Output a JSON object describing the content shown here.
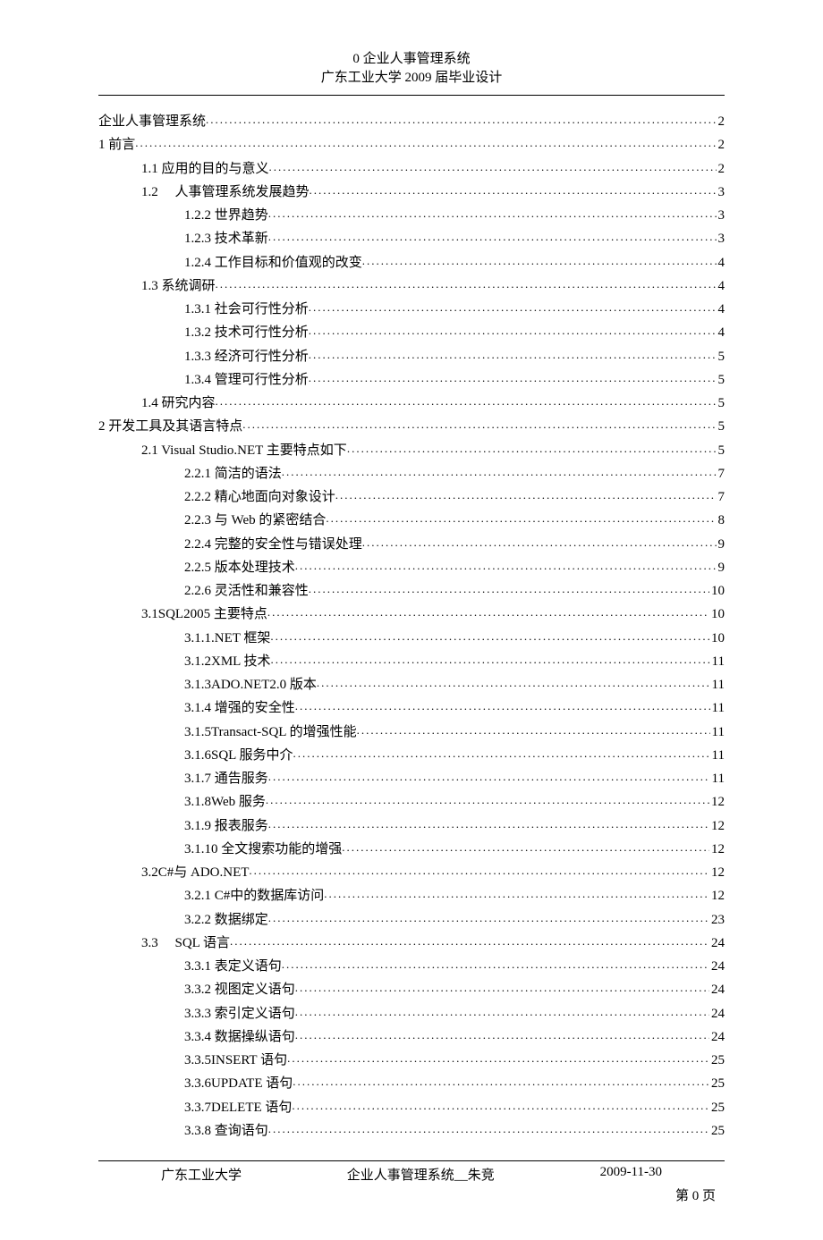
{
  "header": {
    "line1": "0 企业人事管理系统",
    "line2": "广东工业大学 2009 届毕业设计"
  },
  "toc": [
    {
      "level": 0,
      "title": "企业人事管理系统",
      "page": "2"
    },
    {
      "level": 0,
      "title": "1 前言",
      "page": "2"
    },
    {
      "level": 1,
      "title": "1.1 应用的目的与意义",
      "page": "2"
    },
    {
      "level": 1,
      "title": "1.2 　人事管理系统发展趋势",
      "page": "3"
    },
    {
      "level": 2,
      "title": "1.2.2 世界趋势",
      "page": "3"
    },
    {
      "level": 2,
      "title": "1.2.3 技术革新",
      "page": "3"
    },
    {
      "level": 2,
      "title": "1.2.4 工作目标和价值观的改变",
      "page": "4"
    },
    {
      "level": 1,
      "title": "1.3 系统调研",
      "page": "4"
    },
    {
      "level": 2,
      "title": "1.3.1 社会可行性分析",
      "page": "4"
    },
    {
      "level": 2,
      "title": "1.3.2 技术可行性分析",
      "page": "4"
    },
    {
      "level": 2,
      "title": "1.3.3 经济可行性分析",
      "page": "5"
    },
    {
      "level": 2,
      "title": "1.3.4 管理可行性分析",
      "page": "5"
    },
    {
      "level": 1,
      "title": "1.4 研究内容",
      "page": "5"
    },
    {
      "level": 0,
      "title": "2 开发工具及其语言特点",
      "page": "5"
    },
    {
      "level": 1,
      "title": "2.1 Visual Studio.NET 主要特点如下",
      "page": "5"
    },
    {
      "level": 2,
      "title": "2.2.1 简洁的语法",
      "page": "7"
    },
    {
      "level": 2,
      "title": "2.2.2 精心地面向对象设计",
      "page": "7"
    },
    {
      "level": 2,
      "title": "2.2.3 与 Web 的紧密结合",
      "page": "8"
    },
    {
      "level": 2,
      "title": "2.2.4 完整的安全性与错误处理",
      "page": "9"
    },
    {
      "level": 2,
      "title": "2.2.5 版本处理技术",
      "page": "9"
    },
    {
      "level": 2,
      "title": "2.2.6 灵活性和兼容性",
      "page": "10"
    },
    {
      "level": 1,
      "title": "3.1SQL2005 主要特点",
      "page": "10"
    },
    {
      "level": 2,
      "title": "3.1.1.NET 框架",
      "page": "10"
    },
    {
      "level": 2,
      "title": "3.1.2XML 技术",
      "page": "11"
    },
    {
      "level": 2,
      "title": "3.1.3ADO.NET2.0 版本",
      "page": "11"
    },
    {
      "level": 2,
      "title": "3.1.4 增强的安全性",
      "page": "11"
    },
    {
      "level": 2,
      "title": "3.1.5Transact-SQL 的增强性能",
      "page": "11"
    },
    {
      "level": 2,
      "title": "3.1.6SQL 服务中介",
      "page": "11"
    },
    {
      "level": 2,
      "title": "3.1.7 通告服务",
      "page": "11"
    },
    {
      "level": 2,
      "title": "3.1.8Web 服务",
      "page": "12"
    },
    {
      "level": 2,
      "title": "3.1.9 报表服务",
      "page": "12"
    },
    {
      "level": 2,
      "title": "3.1.10 全文搜索功能的增强",
      "page": "12"
    },
    {
      "level": 1,
      "title": "3.2C#与 ADO.NET",
      "page": "12"
    },
    {
      "level": 2,
      "title": "3.2.1  C#中的数据库访问",
      "page": "12"
    },
    {
      "level": 2,
      "title": "3.2.2 数据绑定",
      "page": "23"
    },
    {
      "level": 1,
      "title": "3.3 　SQL 语言",
      "page": "24"
    },
    {
      "level": 2,
      "title": "3.3.1 表定义语句",
      "page": "24"
    },
    {
      "level": 2,
      "title": "3.3.2 视图定义语句",
      "page": "24"
    },
    {
      "level": 2,
      "title": "3.3.3 索引定义语句",
      "page": "24"
    },
    {
      "level": 2,
      "title": "3.3.4 数据操纵语句",
      "page": "24"
    },
    {
      "level": 2,
      "title": "3.3.5INSERT 语句",
      "page": "25"
    },
    {
      "level": 2,
      "title": "3.3.6UPDATE 语句",
      "page": "25"
    },
    {
      "level": 2,
      "title": "3.3.7DELETE 语句",
      "page": "25"
    },
    {
      "level": 2,
      "title": "3.3.8 查询语句",
      "page": "25"
    }
  ],
  "footer": {
    "left": "广东工业大学",
    "center": "企业人事管理系统__朱竞",
    "right": "2009-11-30",
    "pagenum": "第 0 页"
  }
}
